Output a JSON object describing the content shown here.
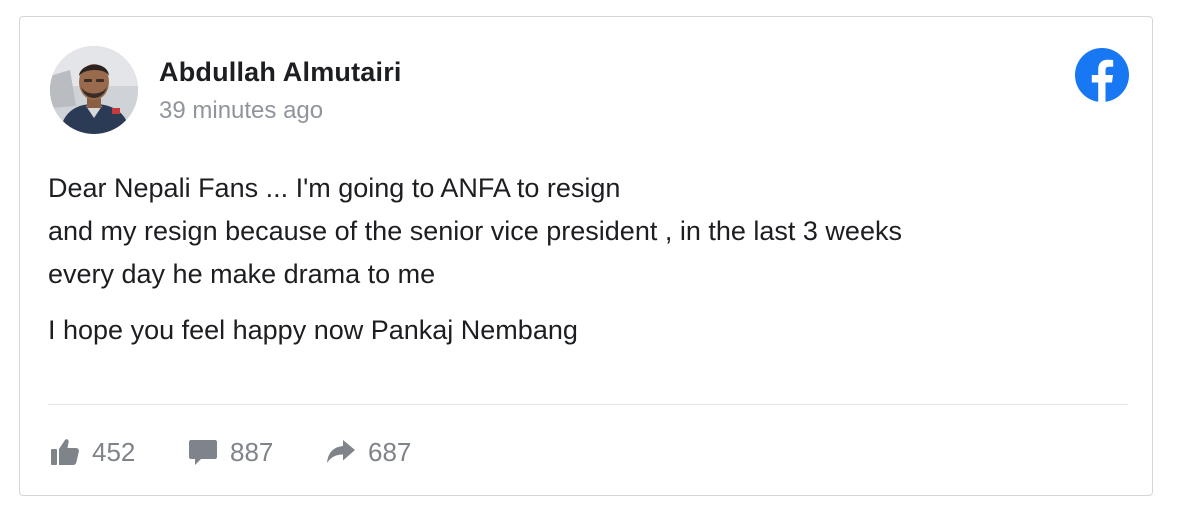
{
  "post": {
    "author": "Abdullah Almutairi",
    "timestamp": "39 minutes ago",
    "paragraphs": [
      "Dear Nepali Fans ... I'm going to ANFA to resign",
      "and my resign because of the senior vice president , in the last 3 weeks",
      "every day he make drama to me",
      "I hope you feel happy now Pankaj Nembang"
    ]
  },
  "stats": {
    "likes": "452",
    "comments": "887",
    "shares": "687"
  },
  "icons": {
    "platform": "facebook-logo-icon",
    "likes": "thumbs-up-icon",
    "comments": "comment-bubble-icon",
    "shares": "share-arrow-icon"
  },
  "colors": {
    "facebook_blue": "#1877f2",
    "text": "#1c1e21",
    "muted": "#90949c",
    "stat_gray": "#7f838a"
  }
}
